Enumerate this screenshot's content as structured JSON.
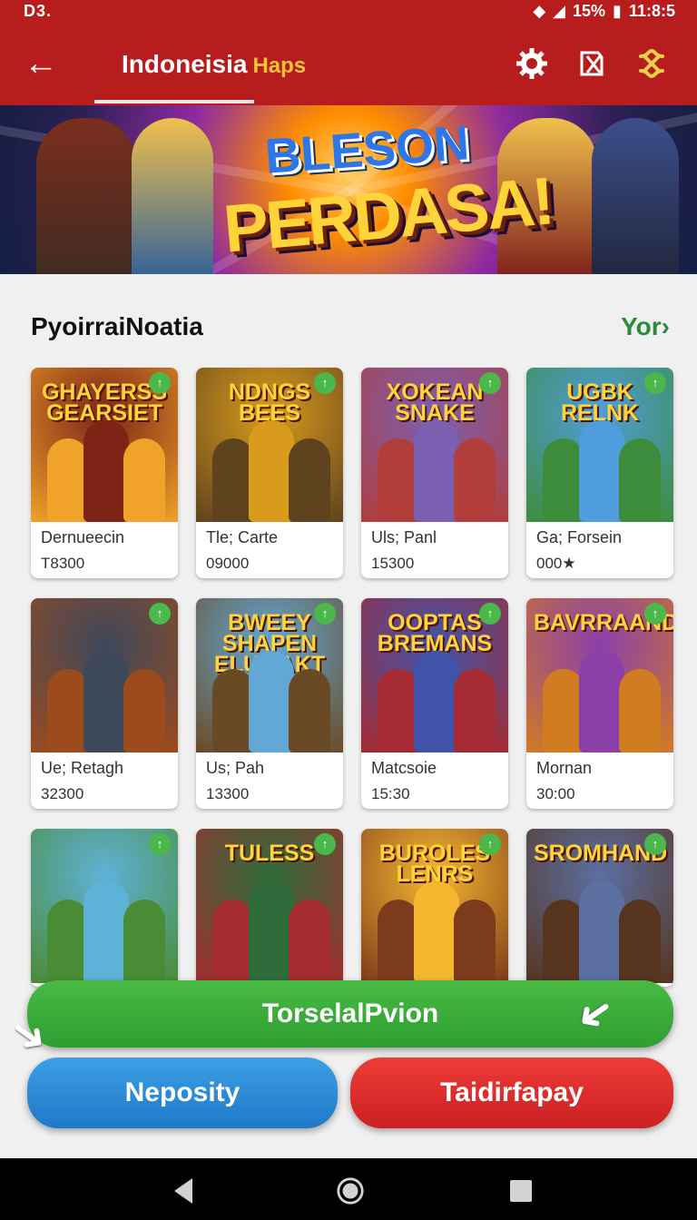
{
  "status_bar": {
    "left": "D3.",
    "battery": "15%",
    "time": "11:8:5"
  },
  "app_bar": {
    "title": "Indoneisia",
    "title_accent": "Haps"
  },
  "banner": {
    "title_line1": "BLESON",
    "title_line2": "PERDASA!"
  },
  "section": {
    "title": "PyoirraiNoatia",
    "more_label": "Yor›"
  },
  "cards": [
    {
      "art": "GHAYERSS GEARSIET",
      "name": "Dernueecin",
      "count": "T8300"
    },
    {
      "art": "NDNGS BEES",
      "name": "Tle; Carte",
      "count": "09000"
    },
    {
      "art": "XOKEAN SNAKE",
      "name": "Uls; Panl",
      "count": "15300"
    },
    {
      "art": "UGBK RELNK",
      "name": "Ga; Forsein",
      "count": "000★"
    },
    {
      "art": "",
      "name": "Ue; Retagh",
      "count": "32300"
    },
    {
      "art": "BWEEY SHAPEN ELUMAKT",
      "name": "Us; Pah",
      "count": "13300"
    },
    {
      "art": "OOPTAS BREMANS",
      "name": "Matcsoie",
      "count": "15:30"
    },
    {
      "art": "BAVRRAAND",
      "name": "Mornan",
      "count": "30:00"
    },
    {
      "art": "",
      "name": "",
      "count": ""
    },
    {
      "art": "TULESS",
      "name": "",
      "count": ""
    },
    {
      "art": "BUROLES LENRS",
      "name": "",
      "count": ""
    },
    {
      "art": "SROMHAND",
      "name": "",
      "count": ""
    }
  ],
  "actions": {
    "primary": "TorselalPvion",
    "secondary": "Neposity",
    "danger": "Taidirfapay"
  },
  "nav": {
    "back": "back",
    "home": "home",
    "recent": "recent"
  },
  "colors": {
    "brand_red": "#b71d1d",
    "accent_yellow": "#f3c43b",
    "green": "#2d9f32",
    "blue": "#1f79c8"
  }
}
